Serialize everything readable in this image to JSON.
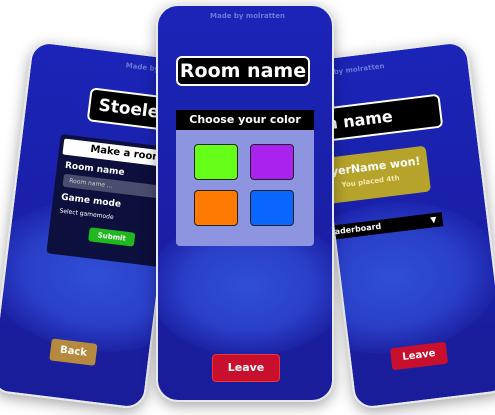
{
  "made_by": "Made by molratten",
  "left_screen": {
    "title": "Stoelenda",
    "form": {
      "header": "Make a room",
      "room_name_label": "Room name",
      "room_name_placeholder": "Room name ...",
      "game_mode_label": "Game mode",
      "game_mode_value": "Select gamemode",
      "submit_label": "Submit"
    },
    "back_label": "Back"
  },
  "center_screen": {
    "title": "Room name",
    "color_picker": {
      "header": "Choose your color",
      "colors": [
        "#66ff1a",
        "#aa22ee",
        "#ff7a00",
        "#0a66ff"
      ]
    },
    "leave_label": "Leave"
  },
  "right_screen": {
    "title": "om name",
    "winner_text": "ayerName won!",
    "placement_text": "You placed 4th",
    "leaderboard_label": "eaderboard",
    "leave_label": "Leave"
  }
}
